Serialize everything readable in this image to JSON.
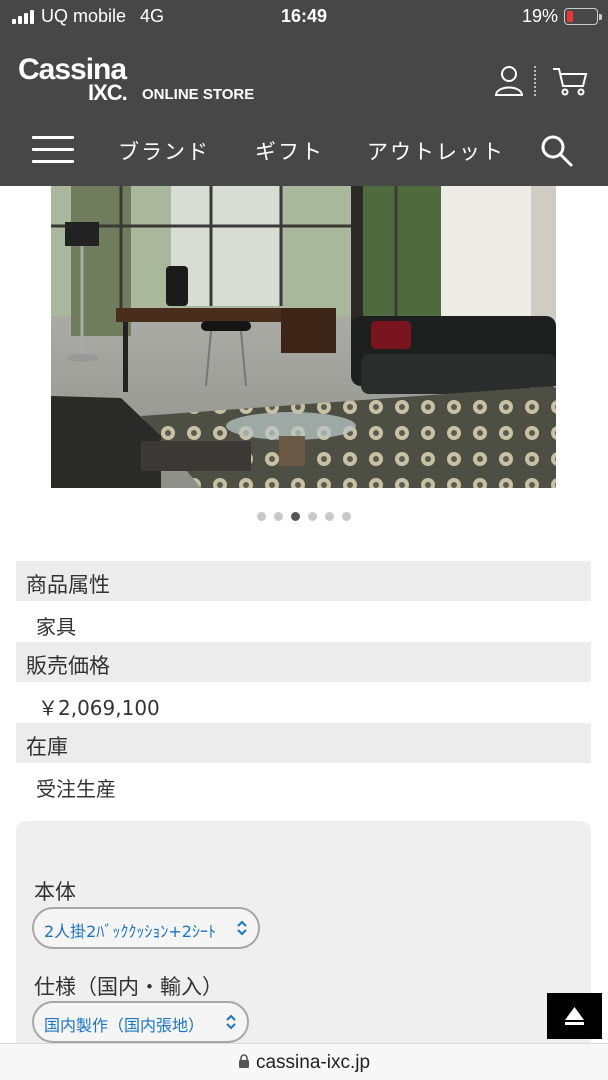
{
  "status_bar": {
    "carrier": "UQ mobile",
    "network": "4G",
    "time": "16:49",
    "battery_percent": "19%",
    "battery_level": 0.19
  },
  "header": {
    "logo_main": "Cassina",
    "logo_sub": "IXC.",
    "logo_tag": "ONLINE STORE",
    "icons": [
      "user-icon",
      "cart-icon"
    ]
  },
  "nav": {
    "items": [
      {
        "label": "ブランド"
      },
      {
        "label": "ギフト"
      },
      {
        "label": "アウトレット"
      }
    ],
    "icons": [
      "menu-icon",
      "search-icon"
    ]
  },
  "carousel": {
    "slide_count": 6,
    "active_index": 2
  },
  "attributes": [
    {
      "label": "商品属性",
      "value": "家具"
    },
    {
      "label": "販売価格",
      "value": "￥2,069,100"
    },
    {
      "label": "在庫",
      "value": "受注生産"
    }
  ],
  "options": [
    {
      "label": "本体",
      "selected": "2人掛2ﾊﾞｯｸｸｯｼｮﾝ+2ｼｰﾄ"
    },
    {
      "label": "仕様（国内・輸入）",
      "selected": "国内製作（国内張地）"
    }
  ],
  "back_to_top": {
    "icon": "arrow-up-icon"
  },
  "url_bar": {
    "url": "cassina-ixc.jp",
    "icon": "lock-icon"
  },
  "colors": {
    "header_bg": "#474747",
    "select_text": "#1a73c7",
    "attr_bg": "#ececec",
    "battery_low": "#e53935"
  }
}
